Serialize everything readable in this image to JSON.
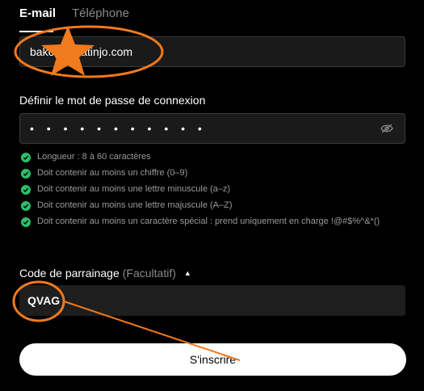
{
  "tabs": [
    {
      "label": "E-mail",
      "active": true
    },
    {
      "label": "Téléphone",
      "active": false
    }
  ],
  "email": {
    "value": "bakog      y@atinjo.com"
  },
  "password": {
    "label": "Définir le mot de passe de connexion",
    "masked": "• • • • • • • • • • •",
    "toggle_icon": "eye-off-icon"
  },
  "requirements": [
    {
      "text": "Longueur : 8 à 60 caractères",
      "met": true
    },
    {
      "text": "Doit contenir au moins un chiffre (0–9)",
      "met": true
    },
    {
      "text": "Doit contenir au moins une lettre minuscule (a–z)",
      "met": true
    },
    {
      "text": "Doit contenir au moins une lettre majuscule (A–Z)",
      "met": true
    },
    {
      "text": "Doit contenir au moins un caractère spécial : prend uniquement en charge !@#$%^&*()",
      "met": true
    }
  ],
  "referral": {
    "label": "Code de parrainage",
    "optional": "(Facultatif)",
    "value": "QVAG",
    "caret": "▲"
  },
  "submit": {
    "label": "S'inscrire"
  },
  "colors": {
    "background": "#000000",
    "success": "#2ebd6a",
    "annotation": "#f07a1e"
  }
}
